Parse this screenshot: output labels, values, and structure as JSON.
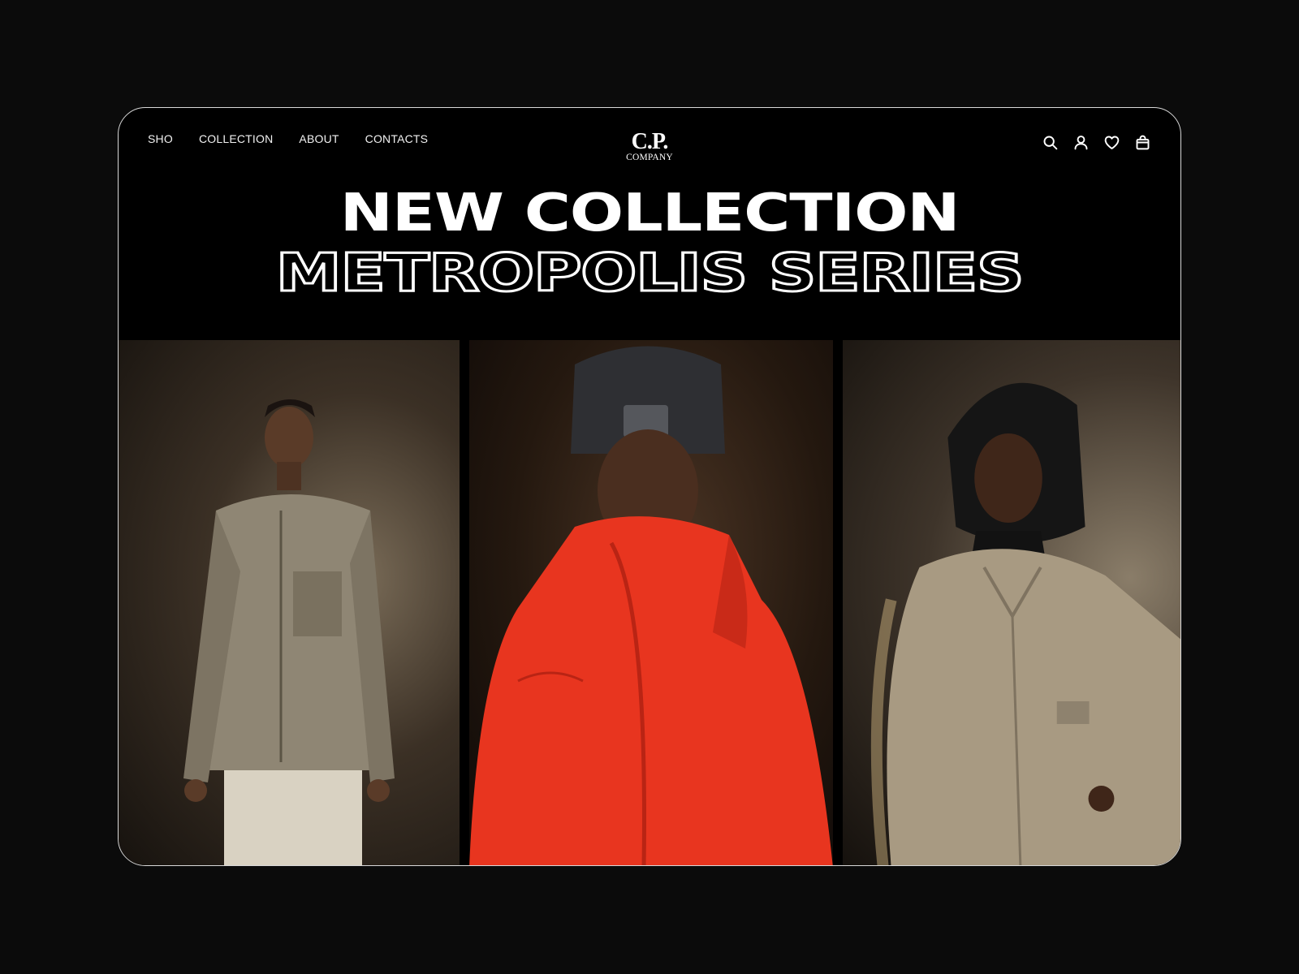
{
  "nav": {
    "items": [
      {
        "label": "SHO"
      },
      {
        "label": "COLLECTION"
      },
      {
        "label": "ABOUT"
      },
      {
        "label": "CONTACTS"
      }
    ]
  },
  "logo": {
    "mark": "C.P.",
    "sub": "COMPANY"
  },
  "icons": [
    "search-icon",
    "account-icon",
    "heart-icon",
    "bag-icon"
  ],
  "hero": {
    "line1": "NEW COLLECTION",
    "line2": "METROPOLIS SERIES"
  },
  "colors": {
    "background": "#0b0b0b",
    "frame_border": "#d9d9d9",
    "text": "#ffffff",
    "jacket_orange": "#e8351f",
    "jacket_beige": "#a89a82"
  }
}
